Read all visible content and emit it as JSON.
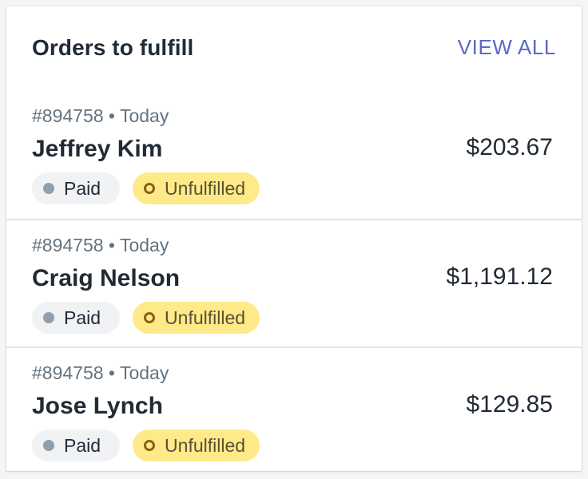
{
  "card": {
    "title": "Orders to fulfill",
    "view_all_label": "VIEW ALL"
  },
  "colors": {
    "accent": "#5c6ac4",
    "text": "#212b36",
    "subdued": "#637381",
    "paid_badge_bg": "#f1f2f4",
    "unfulfilled_badge_bg": "#ffea8a"
  },
  "orders": [
    {
      "meta": "#894758 • Today",
      "customer": "Jeffrey Kim",
      "amount": "$203.67",
      "payment_status": "Paid",
      "fulfillment_status": "Unfulfilled"
    },
    {
      "meta": "#894758 • Today",
      "customer": "Craig Nelson",
      "amount": "$1,191.12",
      "payment_status": "Paid",
      "fulfillment_status": "Unfulfilled"
    },
    {
      "meta": "#894758 • Today",
      "customer": "Jose Lynch",
      "amount": "$129.85",
      "payment_status": "Paid",
      "fulfillment_status": "Unfulfilled"
    }
  ],
  "icons": {
    "paid": "status-dot-icon",
    "unfulfilled": "incomplete-circle-icon"
  }
}
